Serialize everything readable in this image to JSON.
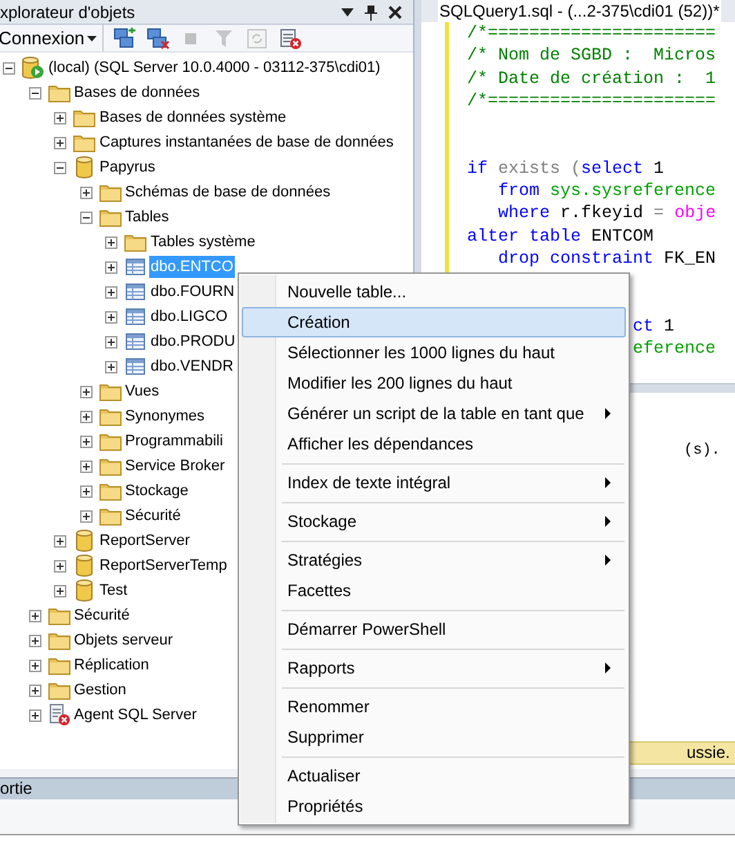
{
  "explorer": {
    "title": "xplorateur d'objets",
    "toolbar": {
      "connect_label": "Connexion",
      "buttons": [
        {
          "kind": "connect",
          "disabled": false
        },
        {
          "kind": "disconnect",
          "disabled": false
        },
        {
          "kind": "stop",
          "disabled": true
        },
        {
          "kind": "filter",
          "disabled": true
        },
        {
          "kind": "refresh",
          "disabled": true
        },
        {
          "kind": "report",
          "disabled": false
        }
      ]
    },
    "tree": [
      {
        "label": "(local) (SQL Server 10.0.4000 - 03112-375\\cdi01)",
        "kind": "server",
        "expanded": true,
        "selected": false,
        "children": [
          {
            "label": "Bases de données",
            "kind": "folder",
            "expanded": true,
            "selected": false,
            "children": [
              {
                "label": "Bases de données système",
                "kind": "folder",
                "expanded": false,
                "selected": false
              },
              {
                "label": "Captures instantanées de base de données",
                "kind": "folder",
                "expanded": false,
                "selected": false
              },
              {
                "label": "Papyrus",
                "kind": "database",
                "expanded": true,
                "selected": false,
                "children": [
                  {
                    "label": "Schémas de base de données",
                    "kind": "folder",
                    "expanded": false,
                    "selected": false
                  },
                  {
                    "label": "Tables",
                    "kind": "folder",
                    "expanded": true,
                    "selected": false,
                    "children": [
                      {
                        "label": "Tables système",
                        "kind": "folder",
                        "expanded": false,
                        "selected": false
                      },
                      {
                        "label": "dbo.ENTCO",
                        "kind": "table",
                        "expanded": false,
                        "selected": true
                      },
                      {
                        "label": "dbo.FOURN",
                        "kind": "table",
                        "expanded": false,
                        "selected": false
                      },
                      {
                        "label": "dbo.LIGCO",
                        "kind": "table",
                        "expanded": false,
                        "selected": false
                      },
                      {
                        "label": "dbo.PRODU",
                        "kind": "table",
                        "expanded": false,
                        "selected": false
                      },
                      {
                        "label": "dbo.VENDR",
                        "kind": "table",
                        "expanded": false,
                        "selected": false
                      }
                    ]
                  },
                  {
                    "label": "Vues",
                    "kind": "folder",
                    "expanded": false,
                    "selected": false
                  },
                  {
                    "label": "Synonymes",
                    "kind": "folder",
                    "expanded": false,
                    "selected": false
                  },
                  {
                    "label": "Programmabili",
                    "kind": "folder",
                    "expanded": false,
                    "selected": false
                  },
                  {
                    "label": "Service Broker",
                    "kind": "folder",
                    "expanded": false,
                    "selected": false
                  },
                  {
                    "label": "Stockage",
                    "kind": "folder",
                    "expanded": false,
                    "selected": false
                  },
                  {
                    "label": "Sécurité",
                    "kind": "folder",
                    "expanded": false,
                    "selected": false
                  }
                ]
              },
              {
                "label": "ReportServer",
                "kind": "database",
                "expanded": false,
                "selected": false
              },
              {
                "label": "ReportServerTemp",
                "kind": "database",
                "expanded": false,
                "selected": false
              },
              {
                "label": "Test",
                "kind": "database",
                "expanded": false,
                "selected": false
              }
            ]
          },
          {
            "label": "Sécurité",
            "kind": "folder",
            "expanded": false,
            "selected": false
          },
          {
            "label": "Objets serveur",
            "kind": "folder",
            "expanded": false,
            "selected": false
          },
          {
            "label": "Réplication",
            "kind": "folder",
            "expanded": false,
            "selected": false
          },
          {
            "label": "Gestion",
            "kind": "folder",
            "expanded": false,
            "selected": false
          },
          {
            "label": "Agent SQL Server",
            "kind": "agent",
            "expanded": false,
            "selected": false
          }
        ]
      }
    ]
  },
  "editor": {
    "tab_title": "SQLQuery1.sql - (...2-375\\cdi01 (52))*",
    "lines": [
      {
        "kind": "code",
        "tokens": [
          {
            "text": "/*======================",
            "kind": "comment"
          }
        ]
      },
      {
        "kind": "code",
        "tokens": [
          {
            "text": "/* Nom de SGBD :  Micros",
            "kind": "comment"
          }
        ]
      },
      {
        "kind": "code",
        "tokens": [
          {
            "text": "/* Date de création :  1",
            "kind": "comment"
          }
        ]
      },
      {
        "kind": "code",
        "tokens": [
          {
            "text": "/*======================",
            "kind": "comment"
          }
        ]
      },
      {
        "kind": "blank"
      },
      {
        "kind": "blank"
      },
      {
        "kind": "code",
        "tokens": [
          {
            "text": "if",
            "kind": "keyword"
          },
          {
            "text": " exists (",
            "kind": "operator"
          },
          {
            "text": "select",
            "kind": "keyword"
          },
          {
            "text": " 1",
            "kind": "plain"
          }
        ]
      },
      {
        "kind": "code",
        "tokens": [
          {
            "text": "   from",
            "kind": "keyword"
          },
          {
            "text": " sys.sysreference",
            "kind": "system"
          }
        ]
      },
      {
        "kind": "code",
        "tokens": [
          {
            "text": "   where",
            "kind": "keyword"
          },
          {
            "text": " r.fkeyid ",
            "kind": "plain"
          },
          {
            "text": "=",
            "kind": "operator"
          },
          {
            "text": " obje",
            "kind": "function"
          }
        ]
      },
      {
        "kind": "code",
        "tokens": [
          {
            "text": "alter table",
            "kind": "keyword"
          },
          {
            "text": " ENTCOM",
            "kind": "plain"
          }
        ]
      },
      {
        "kind": "code",
        "tokens": [
          {
            "text": "   drop constraint",
            "kind": "keyword"
          },
          {
            "text": " FK_EN",
            "kind": "plain"
          }
        ]
      },
      {
        "kind": "blank"
      },
      {
        "kind": "blank"
      },
      {
        "kind": "code",
        "tokens": [
          {
            "text": "                ct",
            "kind": "keyword"
          },
          {
            "text": " 1",
            "kind": "plain"
          }
        ]
      },
      {
        "kind": "code",
        "tokens": [
          {
            "text": "                eference",
            "kind": "system"
          }
        ]
      }
    ],
    "results_text": "(s).",
    "status_text": "ussie."
  },
  "output_panel": {
    "title": "ortie"
  },
  "context_menu": {
    "items": [
      {
        "kind": "item",
        "label": "Nouvelle table...",
        "selected": false,
        "submenu": false
      },
      {
        "kind": "item",
        "label": "Création",
        "selected": true,
        "submenu": false
      },
      {
        "kind": "item",
        "label": "Sélectionner les 1000 lignes du haut",
        "selected": false,
        "submenu": false
      },
      {
        "kind": "item",
        "label": "Modifier les 200 lignes du haut",
        "selected": false,
        "submenu": false
      },
      {
        "kind": "item",
        "label": "Générer un script de la table en tant que",
        "selected": false,
        "submenu": true
      },
      {
        "kind": "item",
        "label": "Afficher les dépendances",
        "selected": false,
        "submenu": false
      },
      {
        "kind": "separator"
      },
      {
        "kind": "item",
        "label": "Index de texte intégral",
        "selected": false,
        "submenu": true
      },
      {
        "kind": "separator"
      },
      {
        "kind": "item",
        "label": "Stockage",
        "selected": false,
        "submenu": true
      },
      {
        "kind": "separator"
      },
      {
        "kind": "item",
        "label": "Stratégies",
        "selected": false,
        "submenu": true
      },
      {
        "kind": "item",
        "label": "Facettes",
        "selected": false,
        "submenu": false
      },
      {
        "kind": "separator"
      },
      {
        "kind": "item",
        "label": "Démarrer PowerShell",
        "selected": false,
        "submenu": false
      },
      {
        "kind": "separator"
      },
      {
        "kind": "item",
        "label": "Rapports",
        "selected": false,
        "submenu": true
      },
      {
        "kind": "separator"
      },
      {
        "kind": "item",
        "label": "Renommer",
        "selected": false,
        "submenu": false
      },
      {
        "kind": "item",
        "label": "Supprimer",
        "selected": false,
        "submenu": false
      },
      {
        "kind": "separator"
      },
      {
        "kind": "item",
        "label": "Actualiser",
        "selected": false,
        "submenu": false
      },
      {
        "kind": "item",
        "label": "Propriétés",
        "selected": false,
        "submenu": false
      }
    ]
  }
}
